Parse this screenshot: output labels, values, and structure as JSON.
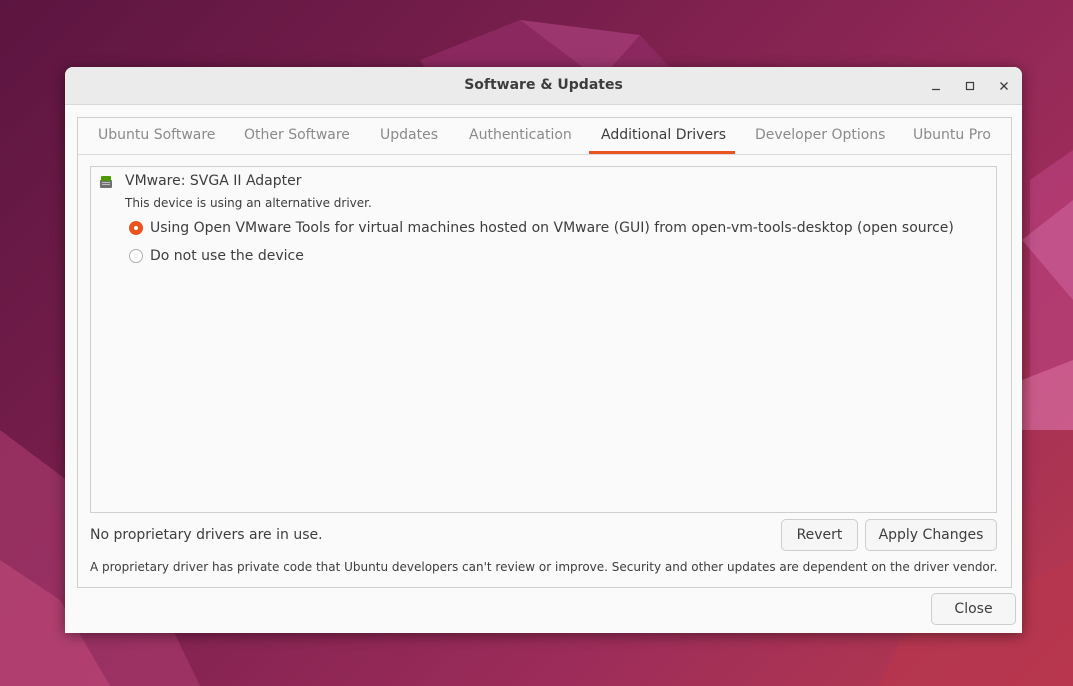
{
  "window": {
    "title": "Software & Updates"
  },
  "titlebar_buttons": [
    "minimize-icon",
    "maximize-icon",
    "close-icon"
  ],
  "tabs": [
    {
      "label": "Ubuntu Software",
      "active": false
    },
    {
      "label": "Other Software",
      "active": false
    },
    {
      "label": "Updates",
      "active": false
    },
    {
      "label": "Authentication",
      "active": false
    },
    {
      "label": "Additional Drivers",
      "active": true
    },
    {
      "label": "Developer Options",
      "active": false
    },
    {
      "label": "Ubuntu Pro",
      "active": false
    }
  ],
  "device": {
    "icon": "hardware-chip-icon",
    "name": "VMware: SVGA II Adapter",
    "status": "This device is using an alternative driver.",
    "options": [
      {
        "label": "Using Open VMware Tools for virtual machines hosted on VMware (GUI) from open-vm-tools-desktop (open source)",
        "selected": true
      },
      {
        "label": "Do not use the device",
        "selected": false
      }
    ]
  },
  "status_text": "No proprietary drivers are in use.",
  "buttons": {
    "revert": "Revert",
    "apply": "Apply Changes",
    "close": "Close"
  },
  "footnote": "A proprietary driver has private code that Ubuntu developers can't review or improve. Security and other updates are dependent on the driver vendor.",
  "colors": {
    "accent": "#e95420",
    "window_bg": "#fafafa",
    "titlebar_bg": "#ebebeb"
  }
}
